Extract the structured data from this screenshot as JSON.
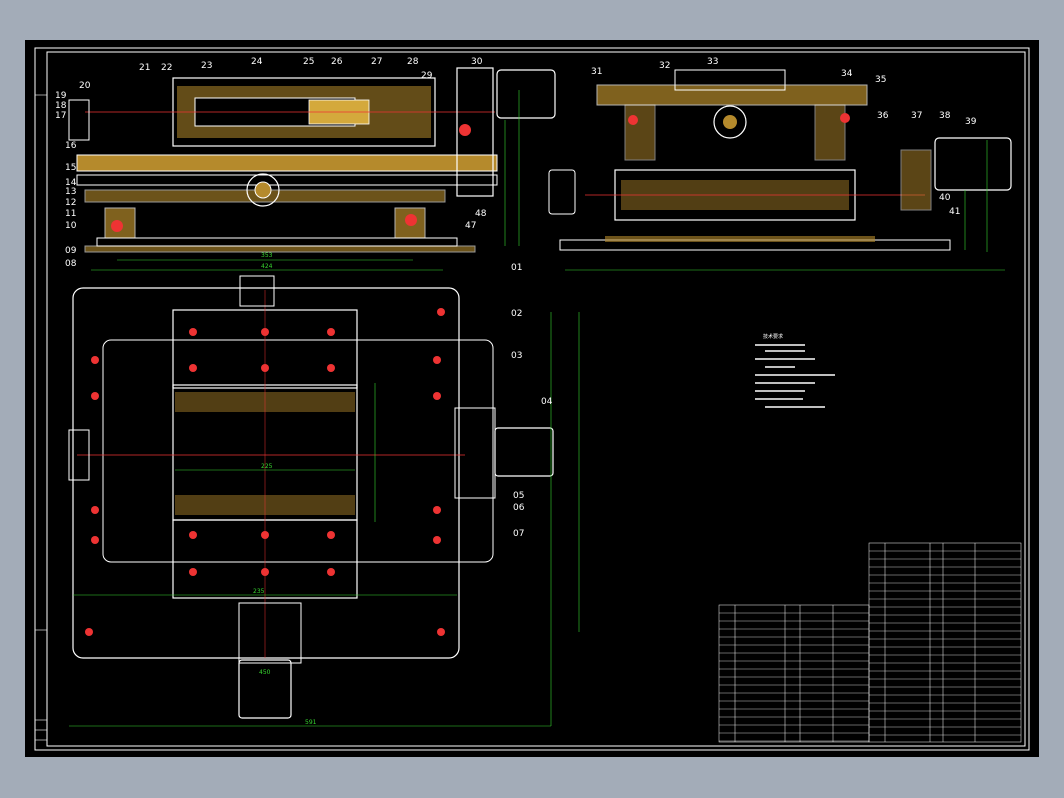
{
  "drawing": {
    "part_labels_left": [
      "19",
      "18",
      "17",
      "16",
      "15",
      "14",
      "13",
      "12",
      "11",
      "10",
      "09",
      "08"
    ],
    "part_labels_top": [
      "20",
      "21",
      "22",
      "23",
      "24",
      "25",
      "26",
      "27",
      "28",
      "29",
      "30"
    ],
    "part_labels_right_top": [
      "31",
      "32",
      "33",
      "34",
      "35",
      "36",
      "37",
      "38",
      "39",
      "40",
      "41"
    ],
    "part_labels_plan": [
      "01",
      "02",
      "03",
      "04",
      "05",
      "06",
      "07"
    ],
    "right_small_labels": [
      "48",
      "47"
    ],
    "dims": {
      "front_353": "353",
      "front_424": "424",
      "plan_225": "225",
      "plan_450": "450",
      "plan_591": "591",
      "plan_inner": "235"
    },
    "tech_req_title": "技术要求"
  }
}
